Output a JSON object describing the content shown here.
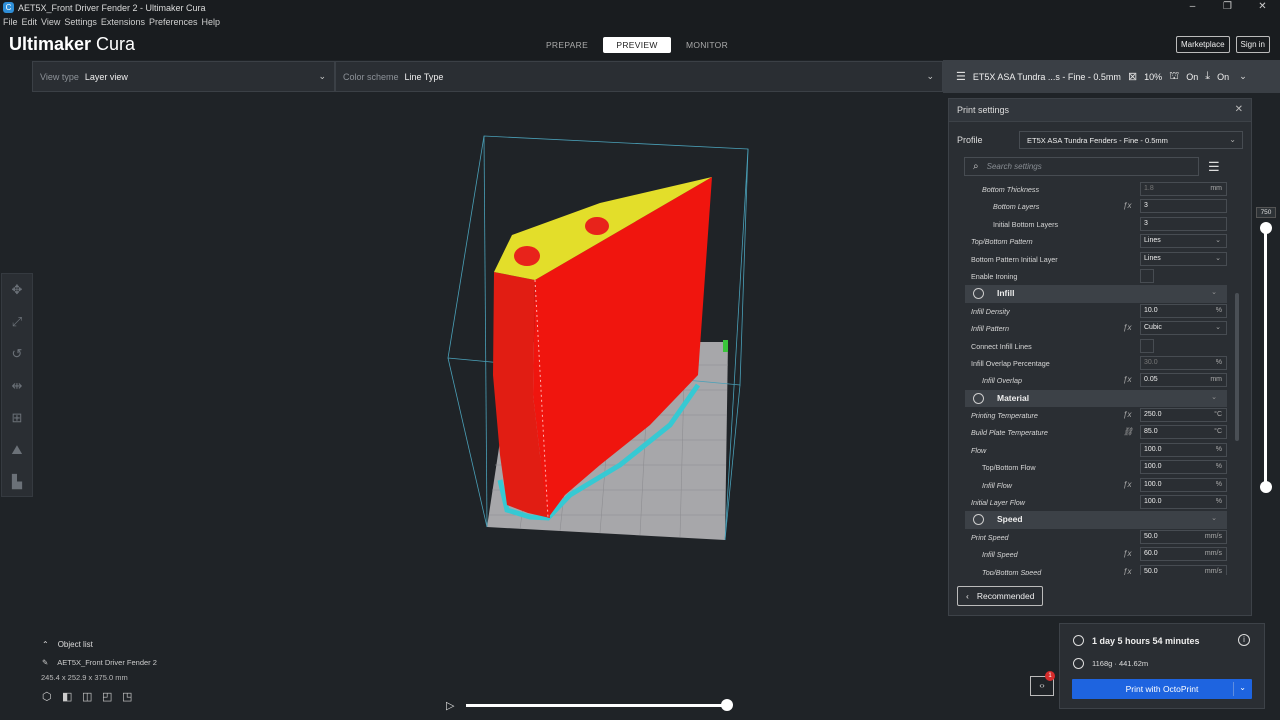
{
  "window": {
    "title": "AET5X_Front Driver Fender 2 - Ultimaker Cura",
    "icon_letter": "C",
    "controls": [
      "–",
      "❐",
      "✕"
    ]
  },
  "menu": [
    "File",
    "Edit",
    "View",
    "Settings",
    "Extensions",
    "Preferences",
    "Help"
  ],
  "header": {
    "logo_bold": "Ultimaker",
    "logo_light": " Cura",
    "stages": [
      "PREPARE",
      "PREVIEW",
      "MONITOR"
    ],
    "active_stage": "PREVIEW",
    "marketplace": "Marketplace",
    "signin": "Sign in"
  },
  "topbar": {
    "view_type_label": "View type",
    "view_type_value": "Layer view",
    "color_scheme_label": "Color scheme",
    "color_scheme_value": "Line Type",
    "print_profile": "ET5X ASA Tundra ...s - Fine - 0.5mm",
    "infill": "10%",
    "support": "On",
    "adhesion": "On"
  },
  "settings_panel": {
    "title": "Print settings",
    "profile_label": "Profile",
    "profile_value": "ET5X ASA Tundra Fenders - Fine - 0.5mm",
    "search_placeholder": "Search settings",
    "recommended": "Recommended",
    "rows": [
      {
        "type": "row",
        "label": "Bottom Thickness",
        "indent": 1,
        "italic": true,
        "value": "1.8",
        "unit": "mm",
        "dim": true
      },
      {
        "type": "row",
        "label": "Bottom Layers",
        "indent": 2,
        "italic": true,
        "fx": true,
        "value": "3"
      },
      {
        "type": "row",
        "label": "Initial Bottom Layers",
        "indent": 2,
        "value": "3"
      },
      {
        "type": "row",
        "label": "Top/Bottom Pattern",
        "indent": 0,
        "italic": true,
        "value": "Lines",
        "dropdown": true
      },
      {
        "type": "row",
        "label": "Bottom Pattern Initial Layer",
        "indent": 0,
        "value": "Lines",
        "dropdown": true
      },
      {
        "type": "row",
        "label": "Enable Ironing",
        "indent": 0,
        "checkbox": true
      },
      {
        "type": "cat",
        "label": "Infill"
      },
      {
        "type": "row",
        "label": "Infill Density",
        "indent": 0,
        "italic": true,
        "value": "10.0",
        "unit": "%"
      },
      {
        "type": "row",
        "label": "Infill Pattern",
        "indent": 0,
        "italic": true,
        "fx": true,
        "value": "Cubic",
        "dropdown": true
      },
      {
        "type": "row",
        "label": "Connect Infill Lines",
        "indent": 0,
        "checkbox": true
      },
      {
        "type": "row",
        "label": "Infill Overlap Percentage",
        "indent": 0,
        "value": "30.0",
        "unit": "%",
        "dim": true
      },
      {
        "type": "row",
        "label": "Infill Overlap",
        "indent": 1,
        "italic": true,
        "fx": true,
        "value": "0.05",
        "unit": "mm"
      },
      {
        "type": "cat",
        "label": "Material"
      },
      {
        "type": "row",
        "label": "Printing Temperature",
        "indent": 0,
        "italic": true,
        "fx": true,
        "value": "250.0",
        "unit": "°C"
      },
      {
        "type": "row",
        "label": "Build Plate Temperature",
        "indent": 0,
        "italic": true,
        "link": true,
        "value": "85.0",
        "unit": "°C"
      },
      {
        "type": "row",
        "label": "Flow",
        "indent": 0,
        "italic": true,
        "value": "100.0",
        "unit": "%"
      },
      {
        "type": "row",
        "label": "Top/Bottom Flow",
        "indent": 1,
        "value": "100.0",
        "unit": "%"
      },
      {
        "type": "row",
        "label": "Infill Flow",
        "indent": 1,
        "italic": true,
        "fx": true,
        "value": "100.0",
        "unit": "%"
      },
      {
        "type": "row",
        "label": "Initial Layer Flow",
        "indent": 0,
        "italic": true,
        "value": "100.0",
        "unit": "%"
      },
      {
        "type": "cat",
        "label": "Speed"
      },
      {
        "type": "row",
        "label": "Print Speed",
        "indent": 0,
        "italic": true,
        "value": "50.0",
        "unit": "mm/s"
      },
      {
        "type": "row",
        "label": "Infill Speed",
        "indent": 1,
        "italic": true,
        "fx": true,
        "value": "60.0",
        "unit": "mm/s"
      },
      {
        "type": "row",
        "label": "Top/Bottom Speed",
        "indent": 1,
        "italic": true,
        "fx": true,
        "value": "50.0",
        "unit": "mm/s"
      }
    ]
  },
  "layer_slider": {
    "top_value": "750"
  },
  "object_list": {
    "header": "Object list",
    "object_name": "AET5X_Front Driver Fender 2",
    "dimensions": "245.4 x 252.9 x 375.0 mm"
  },
  "estimate": {
    "time": "1 day 5 hours 54 minutes",
    "material": "1168g · 441.62m",
    "print_button": "Print with OctoPrint",
    "badge_count": "1"
  }
}
